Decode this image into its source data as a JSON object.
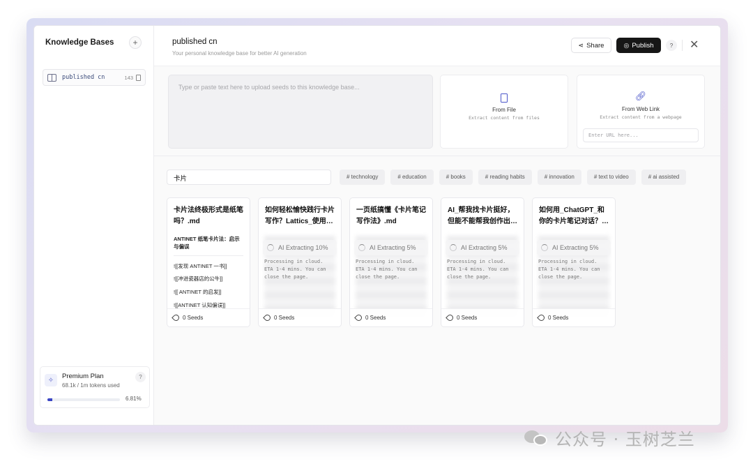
{
  "sidebar": {
    "title": "Knowledge Bases",
    "add_symbol": "+",
    "items": [
      {
        "name": "published cn",
        "count": "143"
      }
    ],
    "plan": {
      "name": "Premium Plan",
      "usage": "68.1k / 1m tokens used",
      "percent_label": "6.81%",
      "percent": 6.81,
      "help": "?"
    }
  },
  "header": {
    "title": "published cn",
    "subtitle": "Your personal knowledge base for better AI generation",
    "share_label": "Share",
    "publish_label": "Publish",
    "help": "?",
    "close": "✕"
  },
  "upload": {
    "placeholder": "Type or paste text here to upload seeds to this knowledge base...",
    "from_file": {
      "title": "From File",
      "desc": "Extract content from files"
    },
    "from_web": {
      "title": "From Web Link",
      "desc": "Extract content from a webpage",
      "placeholder": "Enter URL here..."
    }
  },
  "search": {
    "value": "卡片"
  },
  "tags": [
    "# technology",
    "# education",
    "# books",
    "# reading habits",
    "# innovation",
    "# text to video",
    "# ai assisted"
  ],
  "cards": [
    {
      "title": "卡片法终极形式是纸笔吗？.md",
      "heading": "ANTINET 纸笔卡片法：启示与偏误",
      "lines": [
        "![[发现 ANTINET 一书]]",
        "![[冲进瓷器店的公牛]]",
        "![[ ANTINET 的启发]]",
        "![[ANTINET 认知偏误]]"
      ],
      "seeds": "0 Seeds"
    },
    {
      "title": "如何轻松愉快践行卡片写作？Lattics_使用…",
      "status": "AI Extracting 10%",
      "processing": "Processing in cloud. ETA 1-4 mins. You can close the page.",
      "seeds": "0 Seeds"
    },
    {
      "title": "一页纸搞懂《卡片笔记写作法》.md",
      "status": "AI Extracting 5%",
      "processing": "Processing in cloud. ETA 1-4 mins. You can close the page.",
      "seeds": "0 Seeds"
    },
    {
      "title": "AI_帮我找卡片挺好，但能不能帮我创作出…",
      "status": "AI Extracting 5%",
      "processing": "Processing in cloud. ETA 1-4 mins. You can close the page.",
      "seeds": "0 Seeds"
    },
    {
      "title": "如何用_ChatGPT_和你的卡片笔记对话？…",
      "status": "AI Extracting 5%",
      "processing": "Processing in cloud. ETA 1-4 mins. You can close the page.",
      "seeds": "0 Seeds"
    }
  ],
  "watermark": "公众号 · 玉树芝兰",
  "colors": {
    "accent": "#3b46c4",
    "publish_bg": "#161616"
  }
}
